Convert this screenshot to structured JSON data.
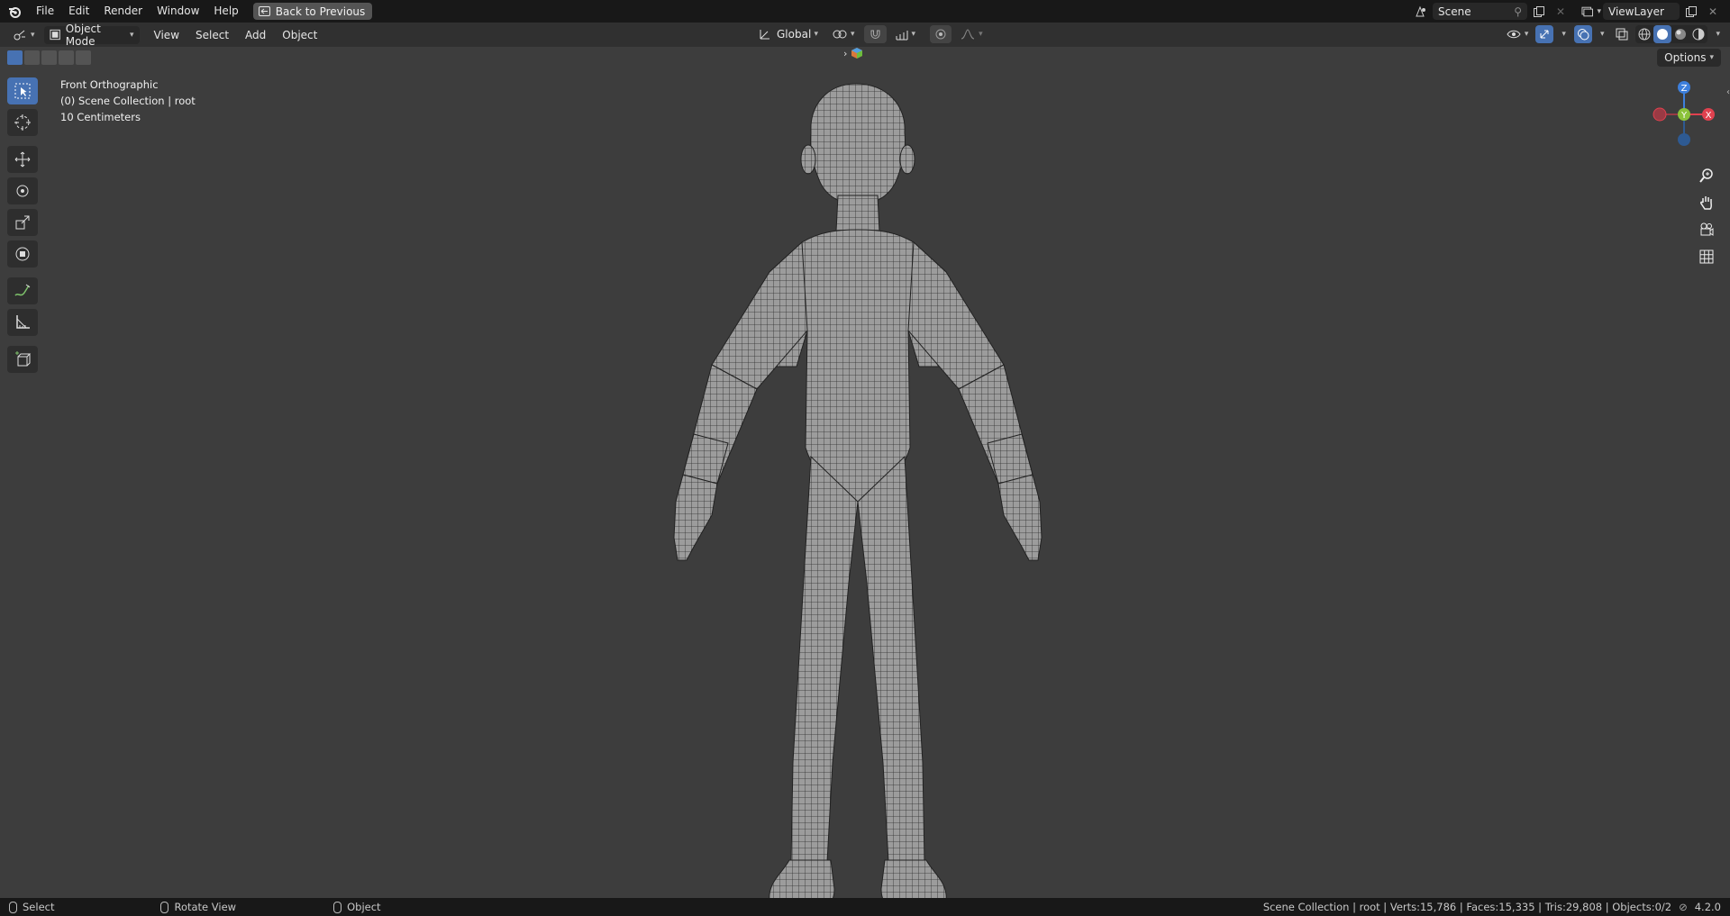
{
  "menu": {
    "items": [
      "File",
      "Edit",
      "Render",
      "Window",
      "Help"
    ],
    "back_button": "Back to Previous"
  },
  "topright": {
    "scene_name": "Scene",
    "view_layer": "ViewLayer"
  },
  "header": {
    "mode": "Object Mode",
    "menus": [
      "View",
      "Select",
      "Add",
      "Object"
    ],
    "transform_orientation": "Global",
    "options_label": "Options"
  },
  "viewport_info": {
    "view": "Front Orthographic",
    "collection": "(0) Scene Collection | root",
    "scale": "10 Centimeters"
  },
  "gizmo": {
    "x_label": "X",
    "y_label": "Y",
    "z_label": "Z",
    "colors": {
      "x": "#e0414f",
      "y": "#8bc23a",
      "z": "#3d7fdc"
    }
  },
  "statusbar": {
    "left": [
      {
        "label": "Select"
      },
      {
        "label": "Rotate View"
      },
      {
        "label": "Object"
      }
    ],
    "stats": "Scene Collection | root | Verts:15,786 | Faces:15,335 | Tris:29,808 | Objects:0/2",
    "version": "4.2.0"
  },
  "colors": {
    "accent": "#4772b3",
    "viewport_bg": "#3d3d3d",
    "topbar_bg": "#181818"
  }
}
